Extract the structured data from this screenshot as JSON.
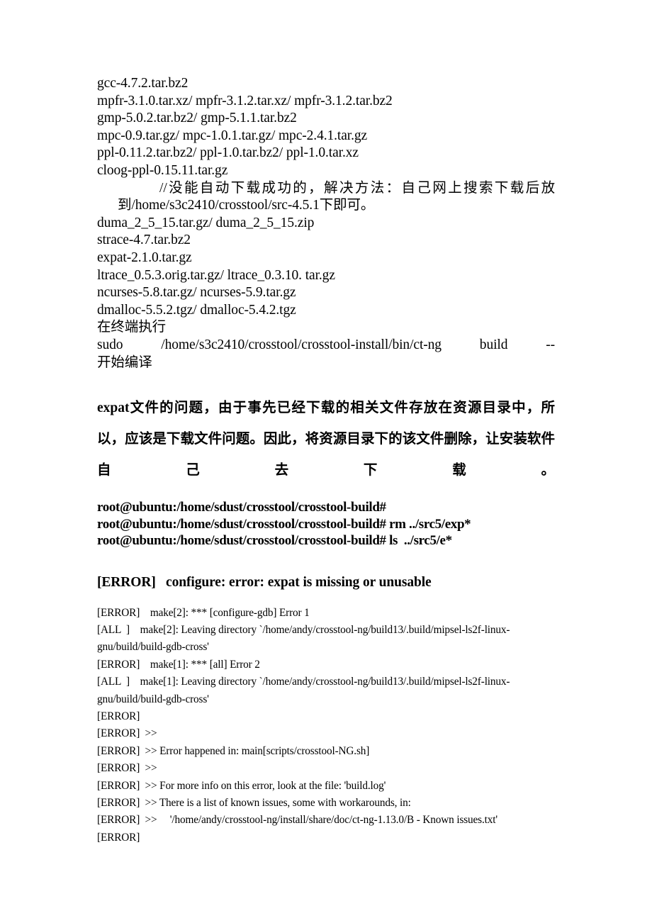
{
  "document": {
    "file_list_top": [
      "gcc-4.7.2.tar.bz2",
      "mpfr-3.1.0.tar.xz/ mpfr-3.1.2.tar.xz/ mpfr-3.1.2.tar.bz2",
      "gmp-5.0.2.tar.bz2/ gmp-5.1.1.tar.bz2",
      "mpc-0.9.tar.gz/ mpc-1.0.1.tar.gz/ mpc-2.4.1.tar.gz",
      "ppl-0.11.2.tar.bz2/ ppl-1.0.tar.bz2/ ppl-1.0.tar.xz",
      "cloog-ppl-0.15.11.tar.gz"
    ],
    "note_line": "//没能自动下载成功的，解决方法：自己网上搜索下载后放到/home/s3c2410/crosstool/src-4.5.1下即可。",
    "file_list_bottom": [
      "duma_2_5_15.tar.gz/ duma_2_5_15.zip",
      "strace-4.7.tar.bz2",
      "expat-2.1.0.tar.gz",
      "ltrace_0.5.3.orig.tar.gz/ ltrace_0.3.10. tar.gz",
      "ncurses-5.8.tar.gz/ ncurses-5.9.tar.gz",
      "dmalloc-5.5.2.tgz/ dmalloc-5.4.2.tgz"
    ],
    "terminal_intro": "在终端执行",
    "command_line": "sudo /home/s3c2410/crosstool/crosstool-install/bin/ct-ng build --",
    "command_tail": "开始编译",
    "bold_paragraph": "expat文件的问题，由于事先已经下载的相关文件存放在资源目录中，所以，应该是下载文件问题。因此，将资源目录下的该文件删除，让安装软件自己去下载。",
    "prompt_lines": [
      "root@ubuntu:/home/sdust/crosstool/crosstool-build#",
      "root@ubuntu:/home/sdust/crosstool/crosstool-build# rm ../src5/exp*",
      "root@ubuntu:/home/sdust/crosstool/crosstool-build# ls  ../src5/e*"
    ],
    "error_heading": "[ERROR]   configure: error: expat is missing or unusable",
    "log_lines": [
      "[ERROR]    make[2]: *** [configure-gdb] Error 1",
      "[ALL  ]    make[2]: Leaving directory `/home/andy/crosstool-ng/build13/.build/mipsel-ls2f-linux-gnu/build/build-gdb-cross'",
      "[ERROR]    make[1]: *** [all] Error 2",
      "[ALL  ]    make[1]: Leaving directory `/home/andy/crosstool-ng/build13/.build/mipsel-ls2f-linux-gnu/build/build-gdb-cross'",
      "[ERROR]",
      "[ERROR]  >>",
      "[ERROR]  >> Error happened in: main[scripts/crosstool-NG.sh]",
      "[ERROR]  >>",
      "[ERROR]  >> For more info on this error, look at the file: 'build.log'",
      "[ERROR]  >> There is a list of known issues, some with workarounds, in:",
      "[ERROR]  >>     '/home/andy/crosstool-ng/install/share/doc/ct-ng-1.13.0/B - Known issues.txt'",
      "[ERROR]"
    ]
  }
}
